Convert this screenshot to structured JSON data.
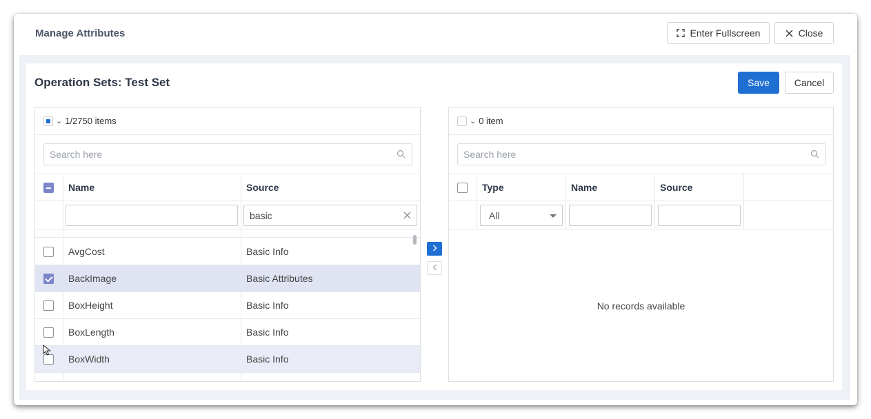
{
  "modal": {
    "title": "Manage Attributes",
    "fullscreen_label": "Enter Fullscreen",
    "close_label": "Close"
  },
  "card": {
    "title": "Operation Sets: Test Set",
    "save_label": "Save",
    "cancel_label": "Cancel"
  },
  "left": {
    "count": "1/2750 items",
    "search_placeholder": "Search here",
    "columns": {
      "name": "Name",
      "source": "Source"
    },
    "filters": {
      "name": "",
      "source": "basic"
    },
    "rows": [
      {
        "name": "AvgCost",
        "source": "Basic Info",
        "checked": false
      },
      {
        "name": "BackImage",
        "source": "Basic Attributes",
        "checked": true
      },
      {
        "name": "BoxHeight",
        "source": "Basic Info",
        "checked": false
      },
      {
        "name": "BoxLength",
        "source": "Basic Info",
        "checked": false
      },
      {
        "name": "BoxWidth",
        "source": "Basic Info",
        "checked": false
      }
    ]
  },
  "right": {
    "count": "0 item",
    "search_placeholder": "Search here",
    "columns": {
      "type": "Type",
      "name": "Name",
      "source": "Source"
    },
    "type_filter": "All",
    "empty_text": "No records available"
  },
  "colors": {
    "primary": "#1f6fd2",
    "selected_row": "#dfe3f2",
    "check": "#7b86c9"
  }
}
